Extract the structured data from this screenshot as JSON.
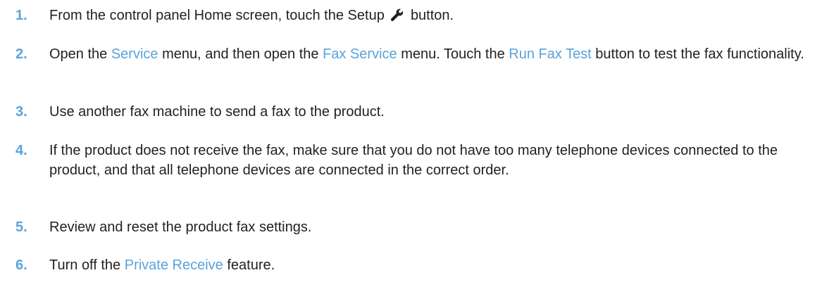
{
  "steps": [
    {
      "number": "1.",
      "before": "From the control panel Home screen, touch the Setup",
      "icon": "wrench-icon",
      "after": "button."
    },
    {
      "number": "2.",
      "t1": "Open the ",
      "link1": "Service",
      "t2": " menu, and then open the ",
      "link2": "Fax Service",
      "t3": " menu. Touch the ",
      "link3": "Run Fax Test",
      "t4": " button to test the fax functionality."
    },
    {
      "number": "3.",
      "text": "Use another fax machine to send a fax to the product."
    },
    {
      "number": "4.",
      "text": "If the product does not receive the fax, make sure that you do not have too many telephone devices connected to the product, and that all telephone devices are connected in the correct order."
    },
    {
      "number": "5.",
      "text": "Review and reset the product fax settings."
    },
    {
      "number": "6.",
      "t1": "Turn off the ",
      "link1": "Private Receive",
      "t2": " feature."
    }
  ],
  "colors": {
    "step_number": "#5aa3db",
    "highlight": "#5aa3db",
    "text": "#231f20"
  }
}
